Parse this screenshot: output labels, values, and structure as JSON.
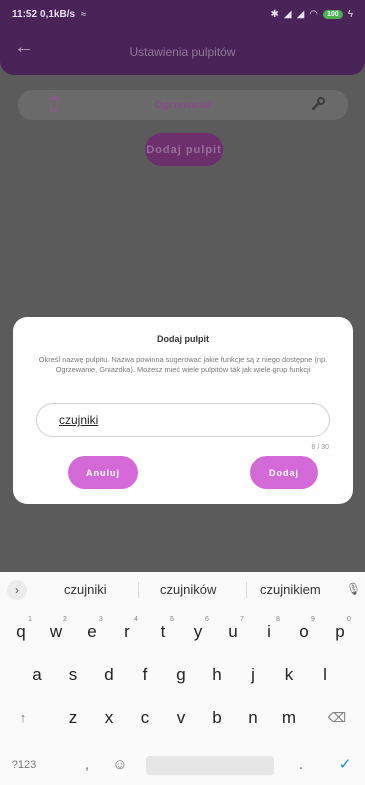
{
  "status": {
    "time": "11:52",
    "net": "0,1kB/s",
    "battery": "100"
  },
  "appbar": {
    "title": "Ustawienia pulpitów"
  },
  "dashboard": {
    "item_name": "Ogrzewanie",
    "add_button": "Dodaj pulpit"
  },
  "dialog": {
    "title": "Dodaj pulpit",
    "description": "Określ nazwę pulpitu. Nazwa powinna sugerować jakie funkcje są z niego dostępne (np. Ogrzewanie, Gniazdka). Możesz mieć wiele pulpitów tak jak wiele grup funkcji",
    "input_value": "czujniki",
    "counter": "8 / 30",
    "cancel_label": "Anuluj",
    "confirm_label": "Dodaj"
  },
  "keyboard": {
    "suggestions": [
      "czujniki",
      "czujników",
      "czujnikiem"
    ],
    "row1": [
      "q",
      "w",
      "e",
      "r",
      "t",
      "y",
      "u",
      "i",
      "o",
      "p"
    ],
    "row1_hints": [
      "1",
      "2",
      "3",
      "4",
      "5",
      "6",
      "7",
      "8",
      "9",
      "0"
    ],
    "row2": [
      "a",
      "s",
      "d",
      "f",
      "g",
      "h",
      "j",
      "k",
      "l"
    ],
    "row3": [
      "z",
      "x",
      "c",
      "v",
      "b",
      "n",
      "m"
    ],
    "symbols_label": "?123",
    "comma": ",",
    "period": "."
  },
  "colors": {
    "accent": "#d469d8",
    "appbar_dimmed": "#4a2358",
    "scrim": "#5b5b5b"
  }
}
